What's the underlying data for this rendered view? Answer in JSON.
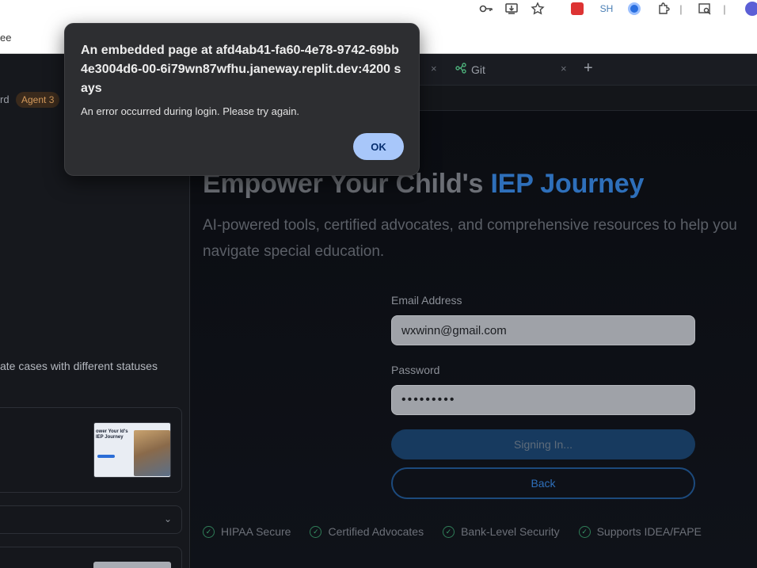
{
  "browser": {
    "bookmark_partial": "ee",
    "icons": [
      "key-icon",
      "install-icon",
      "star-icon",
      "extension-red-icon",
      "extension-sh-icon",
      "extension-c-icon",
      "puzzle-icon",
      "search-tab-icon",
      "profile-icon"
    ],
    "sh_text": "SH"
  },
  "left_panel": {
    "title_partial": "rd",
    "agent_badge": "Agent 3",
    "description_partial": "ate cases with different statuses",
    "thumb_title": "ower Your\nld's IEP Journey"
  },
  "tabs": {
    "git_label": "Git",
    "close_glyph": "×",
    "add_glyph": "+"
  },
  "page": {
    "hero_title_main": "Empower Your Child's ",
    "hero_title_accent": "IEP Journey",
    "hero_subtitle": "AI-powered tools, certified advocates, and comprehensive resources to help you navigate special education.",
    "email_label": "Email Address",
    "email_value": "wxwinn@gmail.com",
    "password_label": "Password",
    "password_value": "•••••••••",
    "signin_label": "Signing In...",
    "back_label": "Back",
    "features": [
      "HIPAA Secure",
      "Certified Advocates",
      "Bank-Level Security",
      "Supports IDEA/FAPE"
    ]
  },
  "dialog": {
    "title": "An embedded page at afd4ab41-fa60-4e78-9742-69bb4e3004d6-00-6i79wn87wfhu.janeway.replit.dev:4200 says",
    "message": "An error occurred during login. Please try again.",
    "ok_label": "OK"
  }
}
